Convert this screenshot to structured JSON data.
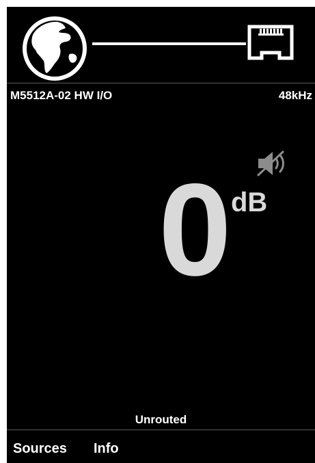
{
  "device": {
    "name": "M5512A-02 HW I/O",
    "sample_rate": "48kHz"
  },
  "connection": {
    "left_icon": "globe-icon",
    "right_icon": "ethernet-port-icon"
  },
  "volume": {
    "value": "0",
    "unit": "dB",
    "muted": true,
    "mute_icon": "speaker-muted-icon"
  },
  "status": "Unrouted",
  "tabs": [
    {
      "label": "Sources"
    },
    {
      "label": "Info"
    }
  ],
  "colors": {
    "background": "#000000",
    "text": "#ffffff",
    "volume_text": "#d9d9d9",
    "mute_icon": "#8c8c8c",
    "divider": "#5a5a5a"
  }
}
